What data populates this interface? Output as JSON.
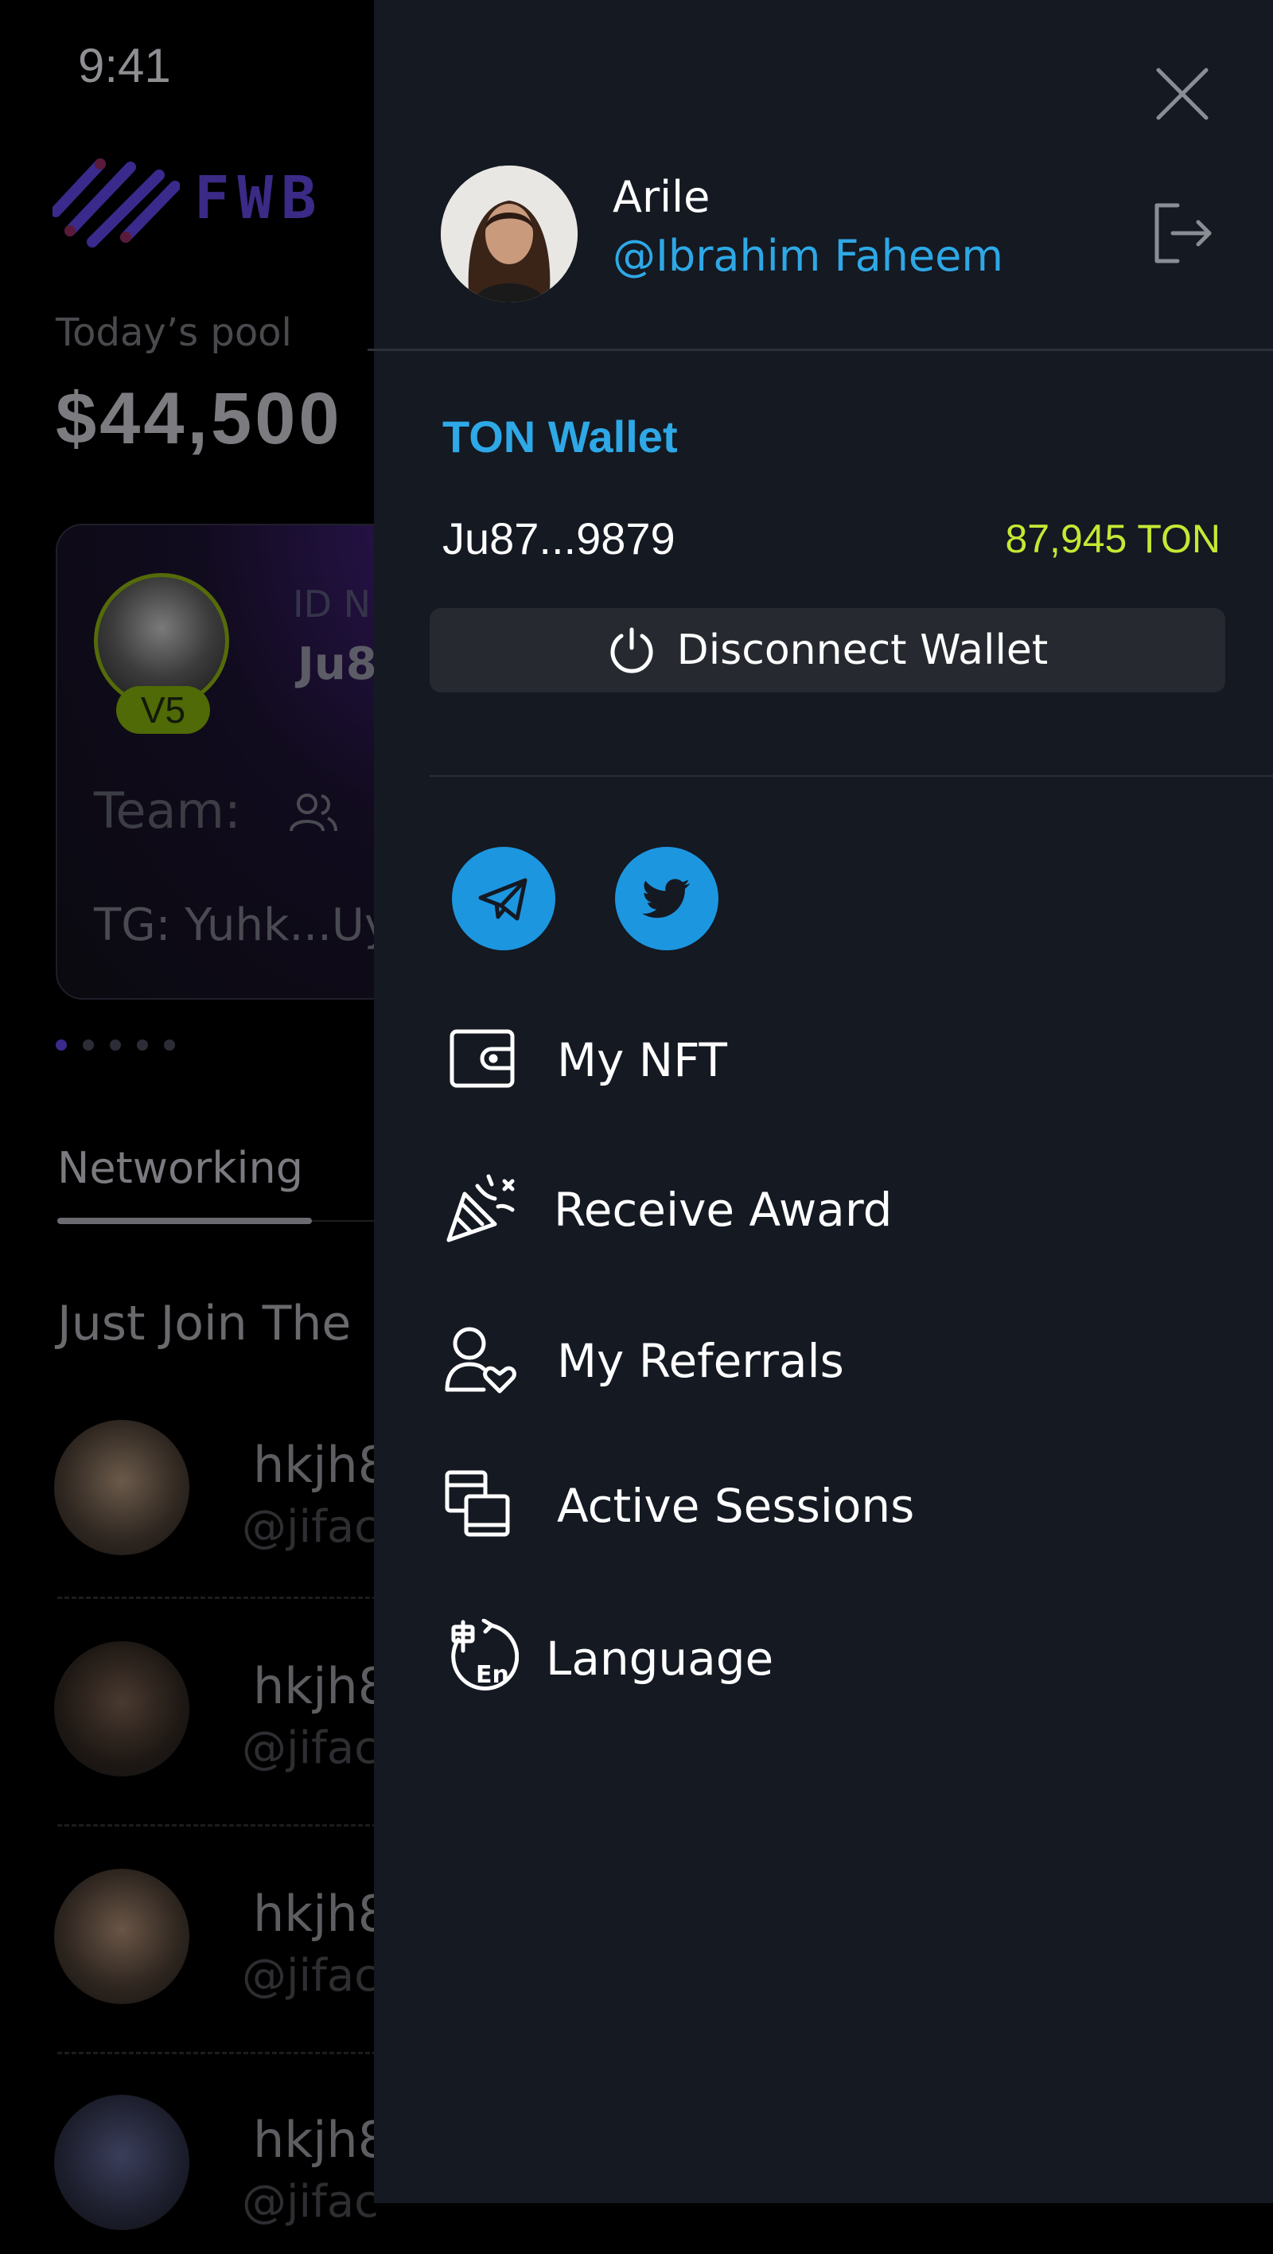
{
  "status_bar": {
    "time": "9:41"
  },
  "background": {
    "brand": "FWB",
    "pool_label": "Today’s pool",
    "pool_value": "$44,500",
    "card": {
      "badge": "V5",
      "id_label": "ID N",
      "id_value": "Ju8",
      "team_label": "Team:",
      "tg": "TG: Yuhk...Uy"
    },
    "tab": "Networking",
    "section_title": "Just Join The",
    "users": [
      {
        "name": "hkjh8",
        "handle": "@jifac"
      },
      {
        "name": "hkjh8",
        "handle": "@jifac"
      },
      {
        "name": "hkjh8",
        "handle": "@jifac"
      },
      {
        "name": "hkjh8",
        "handle": "@jifac"
      }
    ]
  },
  "drawer": {
    "profile": {
      "name": "Arile",
      "handle": "@Ibrahim Faheem"
    },
    "wallet": {
      "title": "TON Wallet",
      "address": "Ju87...9879",
      "balance": "87,945 TON",
      "disconnect_label": "Disconnect Wallet"
    },
    "social": {
      "telegram": "telegram-icon",
      "twitter": "twitter-icon"
    },
    "menu": [
      {
        "label": "My NFT",
        "icon": "wallet-icon"
      },
      {
        "label": "Receive Award",
        "icon": "party-popper-icon"
      },
      {
        "label": "My Referrals",
        "icon": "user-heart-icon"
      },
      {
        "label": "Active Sessions",
        "icon": "devices-icon"
      },
      {
        "label": "Language",
        "icon": "language-icon"
      }
    ]
  },
  "colors": {
    "drawer_bg": "#141922",
    "accent_blue": "#2ea8e6",
    "balance_green": "#c6e834",
    "button_bg": "#262a30",
    "social_blue": "#1d96e0"
  }
}
